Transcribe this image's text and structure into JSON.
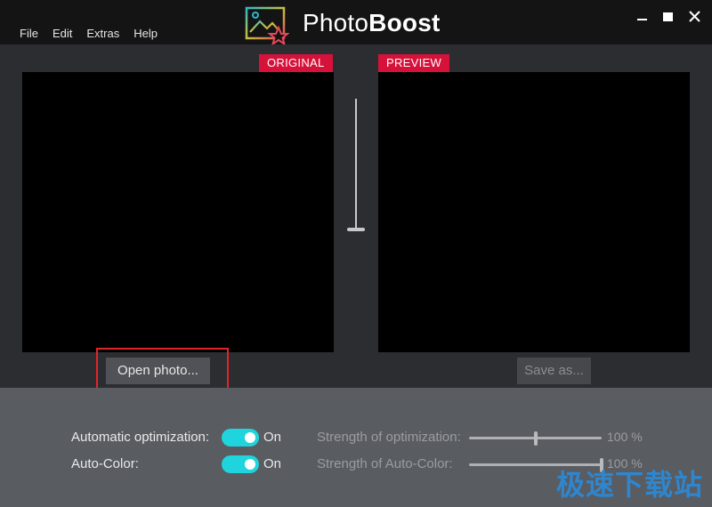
{
  "menu": {
    "items": [
      {
        "label": "File"
      },
      {
        "label": "Edit"
      },
      {
        "label": "Extras"
      },
      {
        "label": "Help"
      }
    ]
  },
  "app": {
    "title_light": "Photo",
    "title_bold": "Boost"
  },
  "window_controls": {
    "minimize_icon": "minimize-icon",
    "maximize_icon": "maximize-icon",
    "close_icon": "close-icon"
  },
  "panels": {
    "original_label": "ORIGINAL",
    "preview_label": "PREVIEW"
  },
  "buttons": {
    "open_photo": "Open photo...",
    "save_as": "Save as..."
  },
  "settings": {
    "rows": [
      {
        "label": "Automatic optimization:",
        "toggle_state": "On",
        "strength_label": "Strength of optimization:",
        "strength_value": "100 %",
        "slider_fraction": 0.5
      },
      {
        "label": "Auto-Color:",
        "toggle_state": "On",
        "strength_label": "Strength of Auto-Color:",
        "strength_value": "100 %",
        "slider_fraction": 1.0
      }
    ]
  },
  "watermark": "极速下载站",
  "colors": {
    "accent_red": "#d6123a",
    "toggle_on": "#1fd4dc",
    "highlight_box": "#e0252b"
  }
}
